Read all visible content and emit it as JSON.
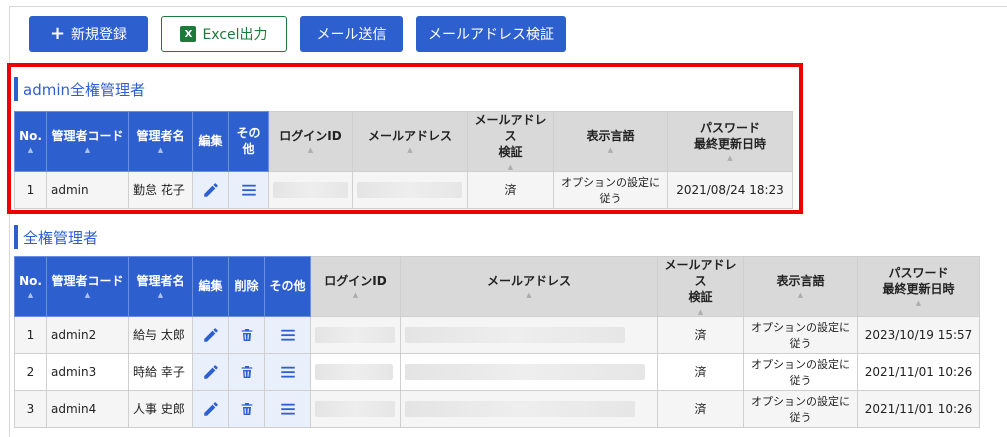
{
  "toolbar": {
    "new_label": "新規登録",
    "excel_label": "Excel出力",
    "mail_label": "メール送信",
    "verify_label": "メールアドレス検証"
  },
  "section1": {
    "title": "admin全権管理者",
    "headers": {
      "no": "No.",
      "code": "管理者コード",
      "name": "管理者名",
      "edit": "編集",
      "other": "その他",
      "login": "ログインID",
      "email": "メールアドレス",
      "verify_l1": "メールアドレス",
      "verify_l2": "検証",
      "lang": "表示言語",
      "pw_l1": "パスワード",
      "pw_l2": "最終更新日時"
    },
    "rows": [
      {
        "no": "1",
        "code": "admin",
        "name": "勤怠 花子",
        "verified": "済",
        "lang": "オプションの設定に従う",
        "updated": "2021/08/24 18:23"
      }
    ]
  },
  "section2": {
    "title": "全権管理者",
    "headers": {
      "no": "No.",
      "code": "管理者コード",
      "name": "管理者名",
      "edit": "編集",
      "delete": "削除",
      "other": "その他",
      "login": "ログインID",
      "email": "メールアドレス",
      "verify_l1": "メールアドレス",
      "verify_l2": "検証",
      "lang": "表示言語",
      "pw_l1": "パスワード",
      "pw_l2": "最終更新日時"
    },
    "rows": [
      {
        "no": "1",
        "code": "admin2",
        "name": "給与 太郎",
        "verified": "済",
        "lang": "オプションの設定に従う",
        "updated": "2023/10/19 15:57"
      },
      {
        "no": "2",
        "code": "admin3",
        "name": "時給 幸子",
        "verified": "済",
        "lang": "オプションの設定に従う",
        "updated": "2021/11/01 10:26"
      },
      {
        "no": "3",
        "code": "admin4",
        "name": "人事 史郎",
        "verified": "済",
        "lang": "オプションの設定に従う",
        "updated": "2021/11/01 10:26"
      }
    ]
  },
  "icons": {
    "edit": "pencil-icon",
    "delete": "trash-icon",
    "other": "menu-icon",
    "sort": "sort-arrow-icon",
    "excel": "excel-icon",
    "plus": "plus-icon"
  },
  "colors": {
    "primary": "#2d5fce",
    "excel_green": "#1e7a3a",
    "highlight": "#ee0000",
    "header_grey": "#d9d9d9"
  }
}
